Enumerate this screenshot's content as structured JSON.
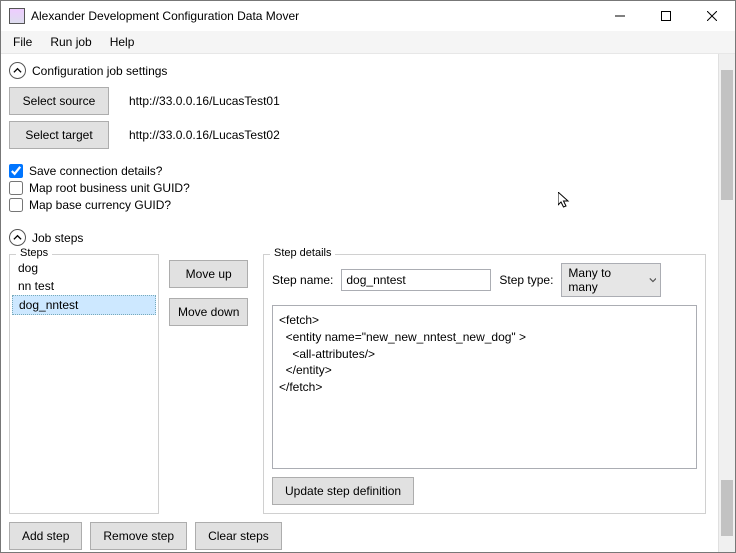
{
  "window": {
    "title": "Alexander Development Configuration Data Mover"
  },
  "menu": {
    "items": [
      "File",
      "Run job",
      "Help"
    ]
  },
  "sections": {
    "config": {
      "title": "Configuration job settings",
      "select_source_label": "Select source",
      "source_url": "http://33.0.0.16/LucasTest01",
      "select_target_label": "Select target",
      "target_url": "http://33.0.0.16/LucasTest02",
      "save_connection_label": "Save connection details?",
      "save_connection_checked": true,
      "map_root_bu_label": "Map root business unit GUID?",
      "map_root_bu_checked": false,
      "map_base_cur_label": "Map base currency GUID?",
      "map_base_cur_checked": false
    },
    "jobsteps": {
      "title": "Job steps",
      "steps_legend": "Steps",
      "step_items": [
        "dog",
        "nn test",
        "dog_nntest"
      ],
      "selected_index": 2,
      "move_up": "Move up",
      "move_down": "Move down",
      "add_step": "Add step",
      "remove_step": "Remove step",
      "clear_steps": "Clear steps"
    },
    "details": {
      "legend": "Step details",
      "step_name_label": "Step name:",
      "step_name_value": "dog_nntest",
      "step_type_label": "Step type:",
      "step_type_value": "Many to many",
      "fetch_xml": "<fetch>\n  <entity name=\"new_new_nntest_new_dog\" >\n    <all-attributes/>\n  </entity>\n</fetch>",
      "update_label": "Update step definition"
    }
  }
}
